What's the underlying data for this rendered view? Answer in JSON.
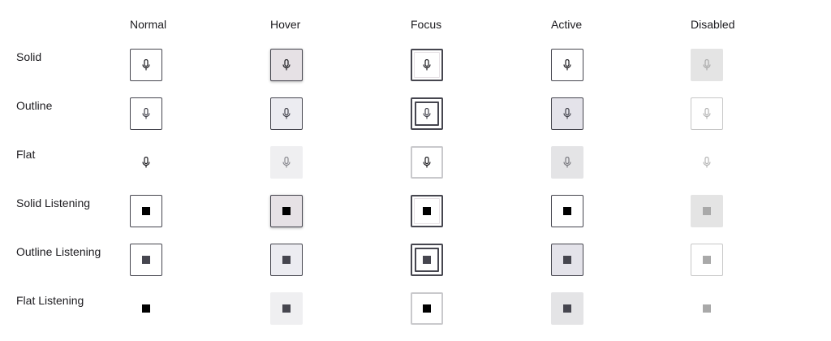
{
  "columns": [
    "Normal",
    "Hover",
    "Focus",
    "Active",
    "Disabled"
  ],
  "rows": [
    "Solid",
    "Outline",
    "Flat",
    "Solid Listening",
    "Outline Listening",
    "Flat Listening"
  ],
  "icons": {
    "idle": "microphone-icon",
    "listening": "stop-icon"
  },
  "colors": {
    "text": "#1c1b1f",
    "border": "#46464f",
    "hover_solid_bg": "#e6e1e5",
    "disabled_bg": "#e4e4e4",
    "disabled_icon": "#a9a9a9"
  }
}
